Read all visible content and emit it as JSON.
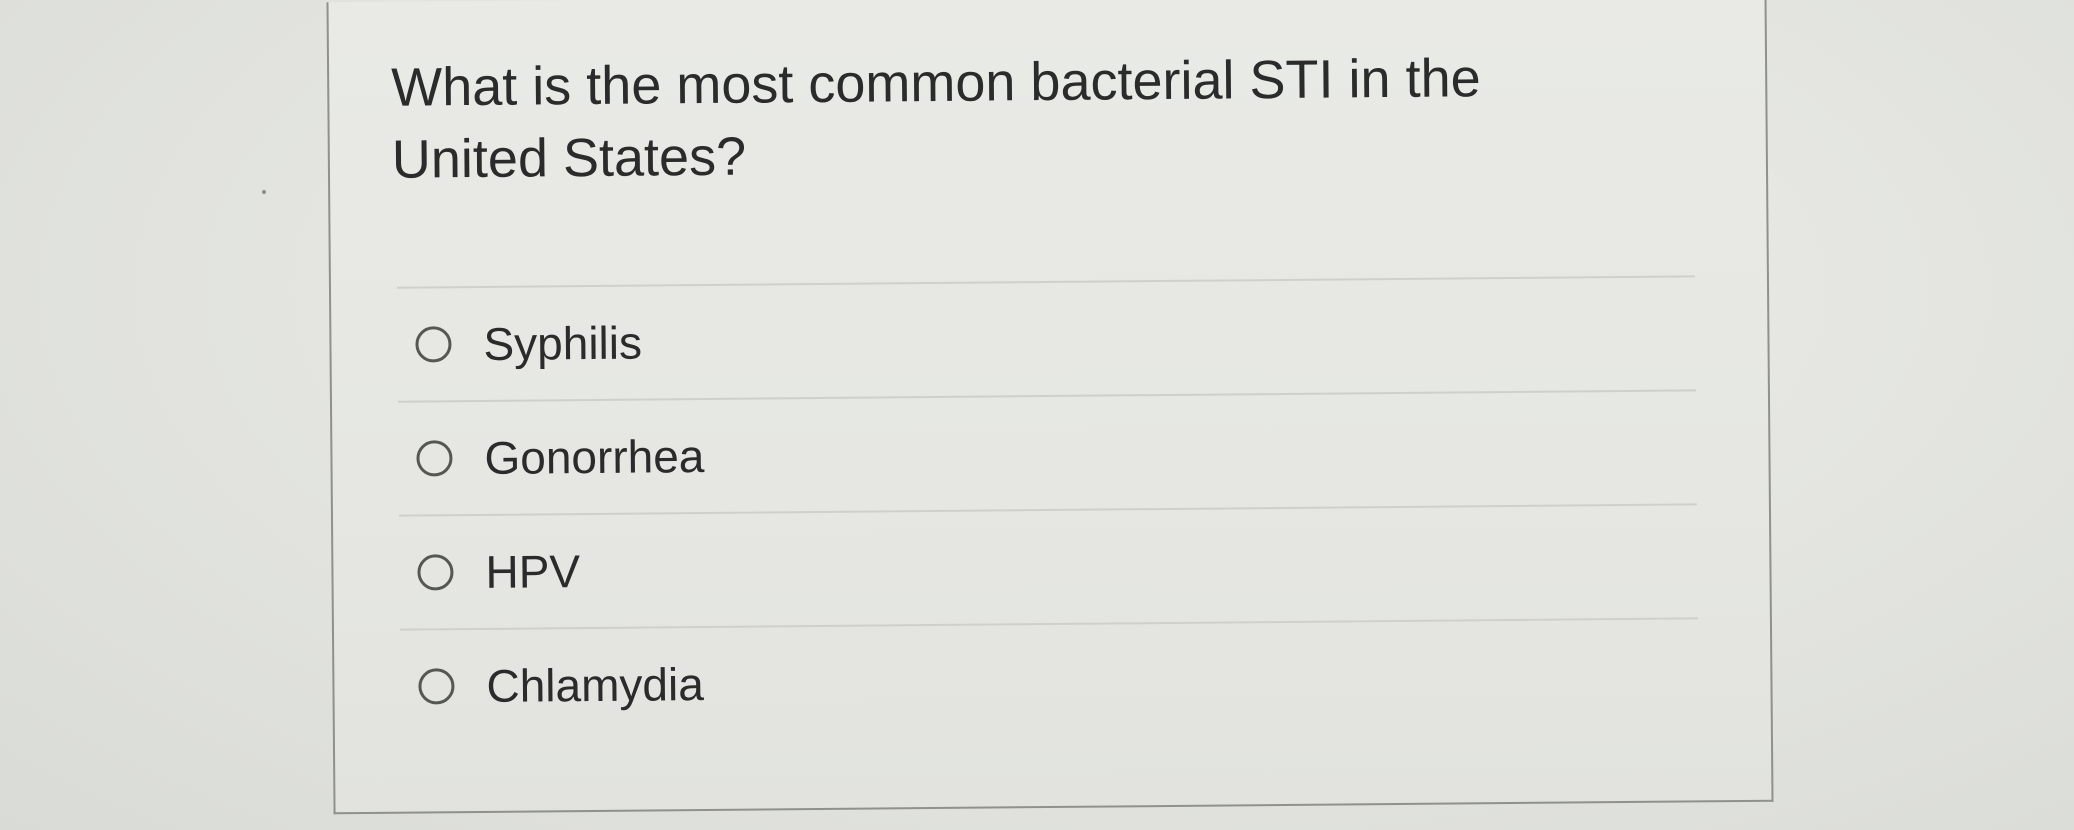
{
  "question": {
    "text": "What is the most common bacterial STI in the United States?"
  },
  "answers": [
    {
      "label": "Syphilis",
      "selected": false
    },
    {
      "label": "Gonorrhea",
      "selected": false
    },
    {
      "label": "HPV",
      "selected": false
    },
    {
      "label": "Chlamydia",
      "selected": false
    }
  ],
  "colors": {
    "text": "#2b2b2b",
    "card_border": "#8f918d",
    "background": "#dfe1dd"
  },
  "icons": {
    "radio": "radio-unselected-icon"
  }
}
